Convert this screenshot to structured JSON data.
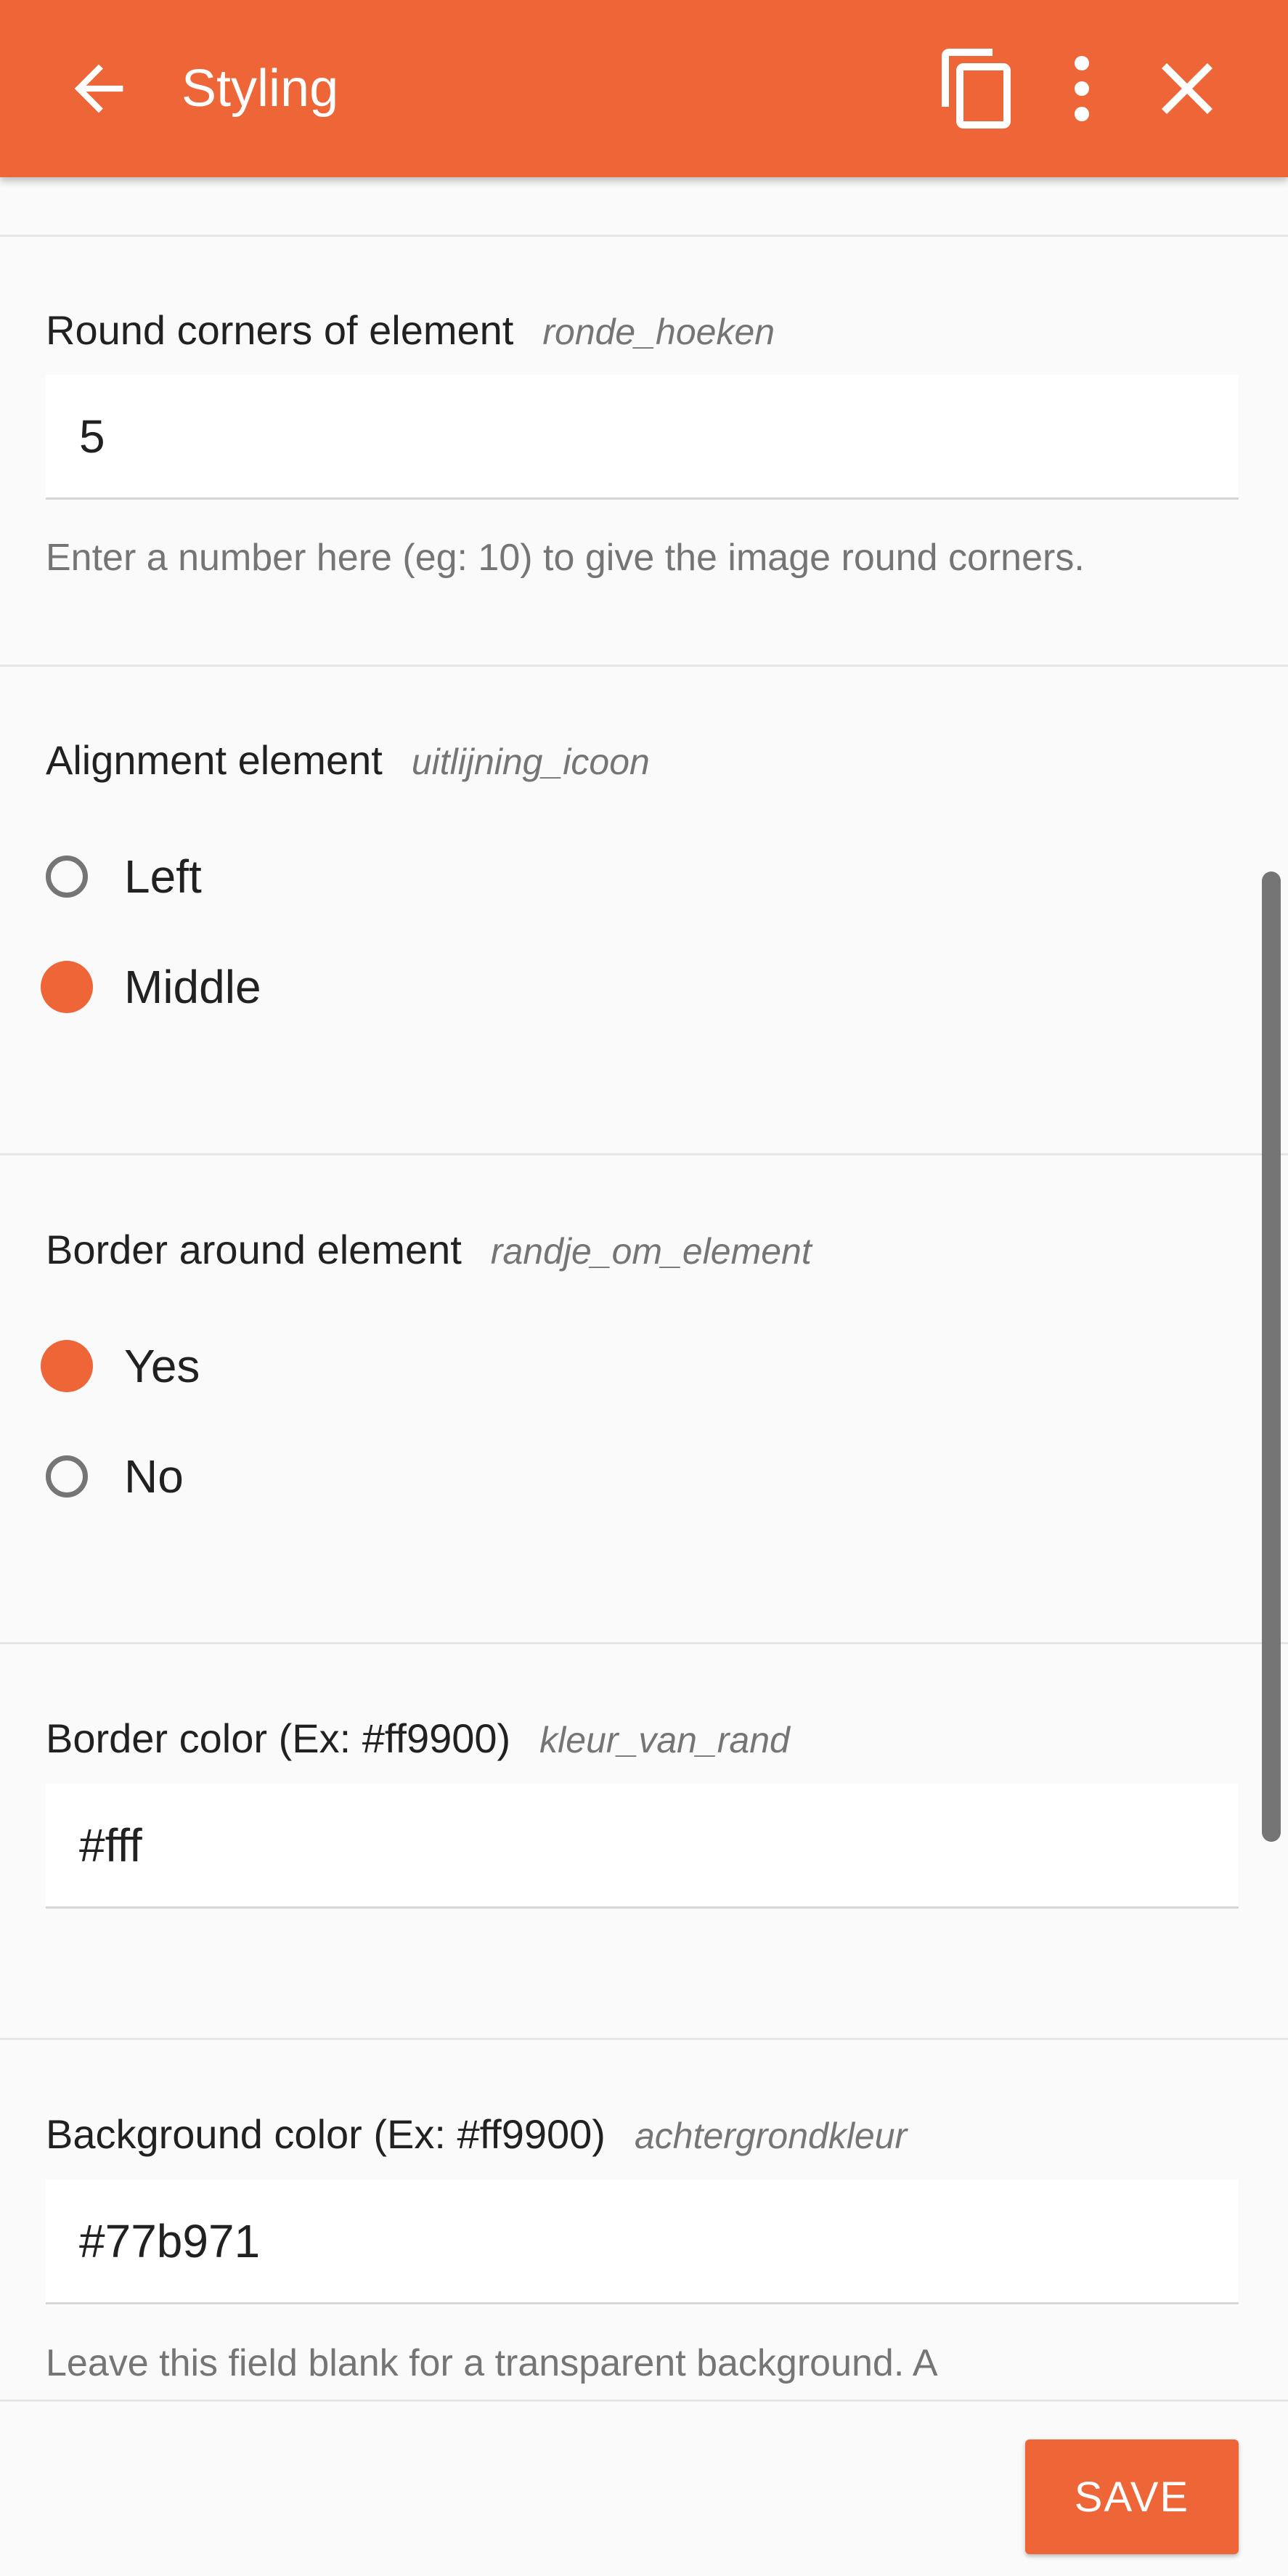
{
  "header": {
    "title": "Styling",
    "back_icon": "arrow-left-icon",
    "copy_icon": "copy-icon",
    "more_icon": "more-vertical-icon",
    "close_icon": "close-icon",
    "bg_color": "#ee6538"
  },
  "sections": {
    "round_corners": {
      "label": "Round corners of element",
      "key": "ronde_hoeken",
      "value": "5",
      "hint": "Enter a number here (eg: 10) to give the image round corners."
    },
    "alignment": {
      "label": "Alignment element",
      "key": "uitlijning_icoon",
      "options": [
        {
          "label": "Left",
          "checked": false
        },
        {
          "label": "Middle",
          "checked": true
        }
      ]
    },
    "border": {
      "label": "Border around element",
      "key": "randje_om_element",
      "options": [
        {
          "label": "Yes",
          "checked": true
        },
        {
          "label": "No",
          "checked": false
        }
      ]
    },
    "border_color": {
      "label": "Border color (Ex: #ff9900)",
      "key": "kleur_van_rand",
      "value": "#fff"
    },
    "background_color": {
      "label": "Background color (Ex: #ff9900)",
      "key": "achtergrondkleur",
      "value": "#77b971",
      "hint": "Leave this field blank for a transparent background. A"
    }
  },
  "footer": {
    "save_label": "SAVE"
  },
  "colors": {
    "accent": "#ee6538",
    "radio_unchecked": "#757575",
    "background": "#fafafa"
  }
}
